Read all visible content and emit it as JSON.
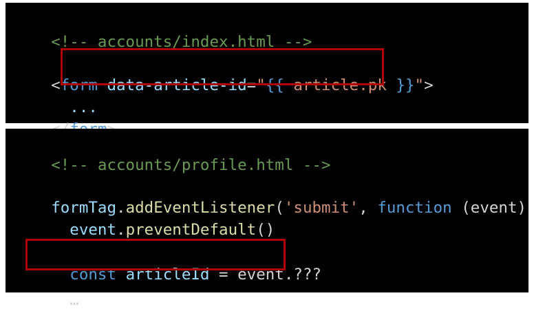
{
  "top_panel": {
    "comment": "<!-- accounts/index.html -->",
    "form_open_lt": "<",
    "form_tag": "form",
    "attr_name": "data-article-id",
    "attr_eq": "=",
    "quote_open": "\"",
    "tpl_open": "{{",
    "tpl_var": " article.pk ",
    "tpl_close": "}}",
    "quote_close": "\"",
    "form_open_gt": ">",
    "ellipsis": "  ...",
    "form_close_lt": "</",
    "form_close_gt": ">"
  },
  "bottom_panel": {
    "comment": "<!-- accounts/profile.html -->",
    "listener_obj": "formTag",
    "listener_dot": ".",
    "listener_method": "addEventListener",
    "listener_paren": "(",
    "listener_event": "'submit'",
    "listener_comma": ", ",
    "listener_function": "function",
    "listener_params": " (event) {",
    "prevent_indent": "  ",
    "prevent_obj": "event",
    "prevent_dot": ".",
    "prevent_method": "preventDefault",
    "prevent_call": "()",
    "const_indent": "  ",
    "const_kw": "const",
    "const_space": " ",
    "const_name": "articleId",
    "const_assign": " = event.???",
    "trailing_ellipsis": "  …"
  },
  "colors": {
    "background": "#000000",
    "highlight": "#b00000",
    "comment": "#6a9955",
    "keyword": "#569cd6",
    "attribute": "#9cdcfe",
    "string": "#ce9178",
    "text": "#d4d4d4"
  }
}
